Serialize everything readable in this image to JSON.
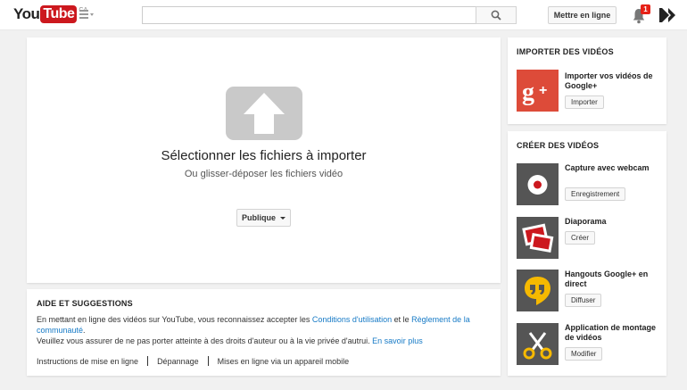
{
  "header": {
    "logo_you": "You",
    "logo_tube": "Tube",
    "logo_country": "CA",
    "search_placeholder": "",
    "upload_button": "Mettre en ligne",
    "notification_count": "1"
  },
  "upload": {
    "title": "Sélectionner les fichiers à importer",
    "subtitle": "Ou glisser-déposer les fichiers vidéo",
    "privacy_value": "Publique"
  },
  "help": {
    "title": "AIDE ET SUGGESTIONS",
    "line1_prefix": "En mettant en ligne des vidéos sur YouTube, vous reconnaissez accepter les ",
    "terms_link": "Conditions d'utilisation",
    "line1_mid": " et le ",
    "guidelines_link": "Règlement de la communauté",
    "line1_suffix": ".",
    "line2_prefix": "Veuillez vous assurer de ne pas porter atteinte à des droits d'auteur ou à la vie privée d'autrui. ",
    "learn_more_link": "En savoir plus",
    "links": [
      "Instructions de mise en ligne",
      "Dépannage",
      "Mises en ligne via un appareil mobile"
    ]
  },
  "import_section": {
    "title": "IMPORTER DES VIDÉOS",
    "item_label": "Importer vos vidéos de Google+",
    "item_button": "Importer"
  },
  "create_section": {
    "title": "CRÉER DES VIDÉOS",
    "items": [
      {
        "label": "Capture avec webcam",
        "button": "Enregistrement"
      },
      {
        "label": "Diaporama",
        "button": "Créer"
      },
      {
        "label": "Hangouts Google+ en direct",
        "button": "Diffuser"
      },
      {
        "label": "Application de montage de vidéos",
        "button": "Modifier"
      }
    ]
  },
  "colors": {
    "brand_red": "#cc181e",
    "google_plus_red": "#dd4b39",
    "hangouts_yellow": "#f6b900",
    "link_blue": "#167ac6",
    "thumb_gray": "#555555"
  },
  "icons": [
    "guide-menu-icon",
    "search-icon",
    "bell-icon",
    "account-avatar-icon",
    "upload-arrow-icon",
    "google-plus-icon",
    "webcam-icon",
    "slideshow-icon",
    "hangouts-icon",
    "scissors-icon"
  ]
}
